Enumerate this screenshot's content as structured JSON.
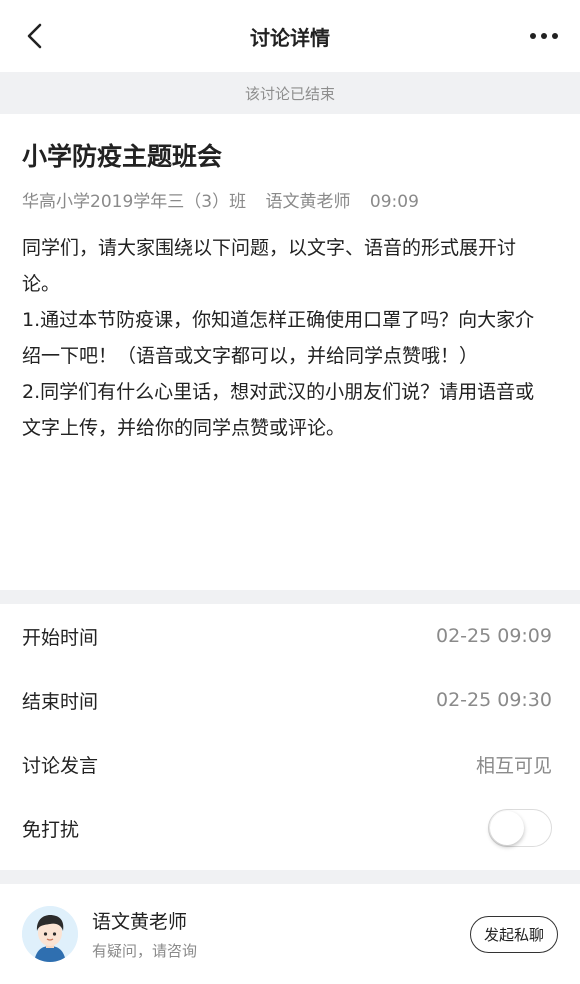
{
  "header": {
    "title": "讨论详情",
    "back_icon": "chevron-left-icon",
    "more_icon": "more-dots-icon"
  },
  "banner": {
    "text": "该讨论已结束"
  },
  "post": {
    "title": "小学防疫主题班会",
    "class_name": "华高小学2019学年三（3）班",
    "author": "语文黄老师",
    "time": "09:09",
    "paragraphs": [
      "同学们，请大家围绕以下问题，以文字、语音的形式展开讨论。",
      "1.通过本节防疫课，你知道怎样正确使用口罩了吗？向大家介绍一下吧！（语音或文字都可以，并给同学点赞哦！）",
      "2.同学们有什么心里话，想对武汉的小朋友们说？请用语音或文字上传，并给你的同学点赞或评论。"
    ]
  },
  "details": {
    "start_label": "开始时间",
    "start_value": "02-25 09:09",
    "end_label": "结束时间",
    "end_value": "02-25 09:30",
    "speech_label": "讨论发言",
    "speech_value": "相互可见",
    "dnd_label": "免打扰",
    "dnd_on": false
  },
  "teacher": {
    "name": "语文黄老师",
    "subtitle": "有疑问，请咨询",
    "button": "发起私聊"
  },
  "colors": {
    "separator": "#f0f1f3",
    "muted_text": "#8a8a8a",
    "primary_text": "#222222"
  }
}
